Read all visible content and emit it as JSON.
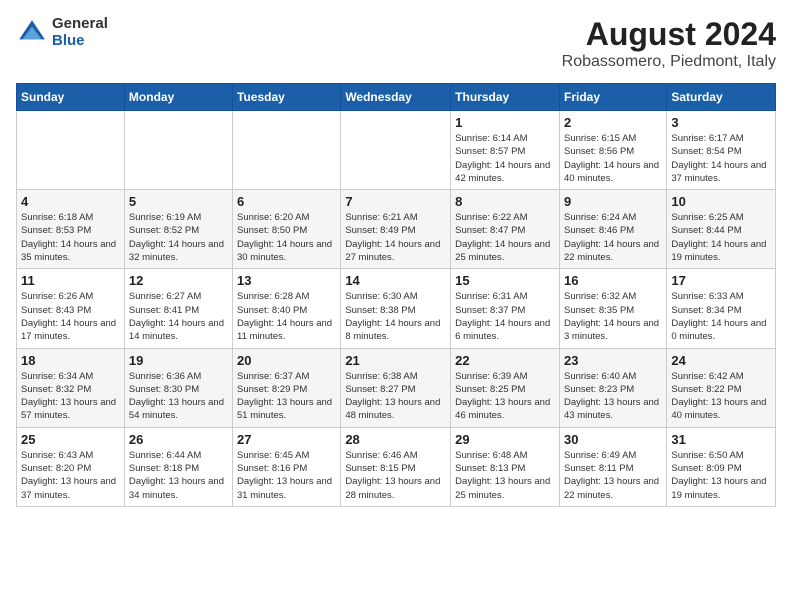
{
  "logo": {
    "general": "General",
    "blue": "Blue"
  },
  "title": "August 2024",
  "subtitle": "Robassomero, Piedmont, Italy",
  "days_of_week": [
    "Sunday",
    "Monday",
    "Tuesday",
    "Wednesday",
    "Thursday",
    "Friday",
    "Saturday"
  ],
  "weeks": [
    [
      {
        "day": "",
        "detail": ""
      },
      {
        "day": "",
        "detail": ""
      },
      {
        "day": "",
        "detail": ""
      },
      {
        "day": "",
        "detail": ""
      },
      {
        "day": "1",
        "detail": "Sunrise: 6:14 AM\nSunset: 8:57 PM\nDaylight: 14 hours and 42 minutes."
      },
      {
        "day": "2",
        "detail": "Sunrise: 6:15 AM\nSunset: 8:56 PM\nDaylight: 14 hours and 40 minutes."
      },
      {
        "day": "3",
        "detail": "Sunrise: 6:17 AM\nSunset: 8:54 PM\nDaylight: 14 hours and 37 minutes."
      }
    ],
    [
      {
        "day": "4",
        "detail": "Sunrise: 6:18 AM\nSunset: 8:53 PM\nDaylight: 14 hours and 35 minutes."
      },
      {
        "day": "5",
        "detail": "Sunrise: 6:19 AM\nSunset: 8:52 PM\nDaylight: 14 hours and 32 minutes."
      },
      {
        "day": "6",
        "detail": "Sunrise: 6:20 AM\nSunset: 8:50 PM\nDaylight: 14 hours and 30 minutes."
      },
      {
        "day": "7",
        "detail": "Sunrise: 6:21 AM\nSunset: 8:49 PM\nDaylight: 14 hours and 27 minutes."
      },
      {
        "day": "8",
        "detail": "Sunrise: 6:22 AM\nSunset: 8:47 PM\nDaylight: 14 hours and 25 minutes."
      },
      {
        "day": "9",
        "detail": "Sunrise: 6:24 AM\nSunset: 8:46 PM\nDaylight: 14 hours and 22 minutes."
      },
      {
        "day": "10",
        "detail": "Sunrise: 6:25 AM\nSunset: 8:44 PM\nDaylight: 14 hours and 19 minutes."
      }
    ],
    [
      {
        "day": "11",
        "detail": "Sunrise: 6:26 AM\nSunset: 8:43 PM\nDaylight: 14 hours and 17 minutes."
      },
      {
        "day": "12",
        "detail": "Sunrise: 6:27 AM\nSunset: 8:41 PM\nDaylight: 14 hours and 14 minutes."
      },
      {
        "day": "13",
        "detail": "Sunrise: 6:28 AM\nSunset: 8:40 PM\nDaylight: 14 hours and 11 minutes."
      },
      {
        "day": "14",
        "detail": "Sunrise: 6:30 AM\nSunset: 8:38 PM\nDaylight: 14 hours and 8 minutes."
      },
      {
        "day": "15",
        "detail": "Sunrise: 6:31 AM\nSunset: 8:37 PM\nDaylight: 14 hours and 6 minutes."
      },
      {
        "day": "16",
        "detail": "Sunrise: 6:32 AM\nSunset: 8:35 PM\nDaylight: 14 hours and 3 minutes."
      },
      {
        "day": "17",
        "detail": "Sunrise: 6:33 AM\nSunset: 8:34 PM\nDaylight: 14 hours and 0 minutes."
      }
    ],
    [
      {
        "day": "18",
        "detail": "Sunrise: 6:34 AM\nSunset: 8:32 PM\nDaylight: 13 hours and 57 minutes."
      },
      {
        "day": "19",
        "detail": "Sunrise: 6:36 AM\nSunset: 8:30 PM\nDaylight: 13 hours and 54 minutes."
      },
      {
        "day": "20",
        "detail": "Sunrise: 6:37 AM\nSunset: 8:29 PM\nDaylight: 13 hours and 51 minutes."
      },
      {
        "day": "21",
        "detail": "Sunrise: 6:38 AM\nSunset: 8:27 PM\nDaylight: 13 hours and 48 minutes."
      },
      {
        "day": "22",
        "detail": "Sunrise: 6:39 AM\nSunset: 8:25 PM\nDaylight: 13 hours and 46 minutes."
      },
      {
        "day": "23",
        "detail": "Sunrise: 6:40 AM\nSunset: 8:23 PM\nDaylight: 13 hours and 43 minutes."
      },
      {
        "day": "24",
        "detail": "Sunrise: 6:42 AM\nSunset: 8:22 PM\nDaylight: 13 hours and 40 minutes."
      }
    ],
    [
      {
        "day": "25",
        "detail": "Sunrise: 6:43 AM\nSunset: 8:20 PM\nDaylight: 13 hours and 37 minutes."
      },
      {
        "day": "26",
        "detail": "Sunrise: 6:44 AM\nSunset: 8:18 PM\nDaylight: 13 hours and 34 minutes."
      },
      {
        "day": "27",
        "detail": "Sunrise: 6:45 AM\nSunset: 8:16 PM\nDaylight: 13 hours and 31 minutes."
      },
      {
        "day": "28",
        "detail": "Sunrise: 6:46 AM\nSunset: 8:15 PM\nDaylight: 13 hours and 28 minutes."
      },
      {
        "day": "29",
        "detail": "Sunrise: 6:48 AM\nSunset: 8:13 PM\nDaylight: 13 hours and 25 minutes."
      },
      {
        "day": "30",
        "detail": "Sunrise: 6:49 AM\nSunset: 8:11 PM\nDaylight: 13 hours and 22 minutes."
      },
      {
        "day": "31",
        "detail": "Sunrise: 6:50 AM\nSunset: 8:09 PM\nDaylight: 13 hours and 19 minutes."
      }
    ]
  ]
}
